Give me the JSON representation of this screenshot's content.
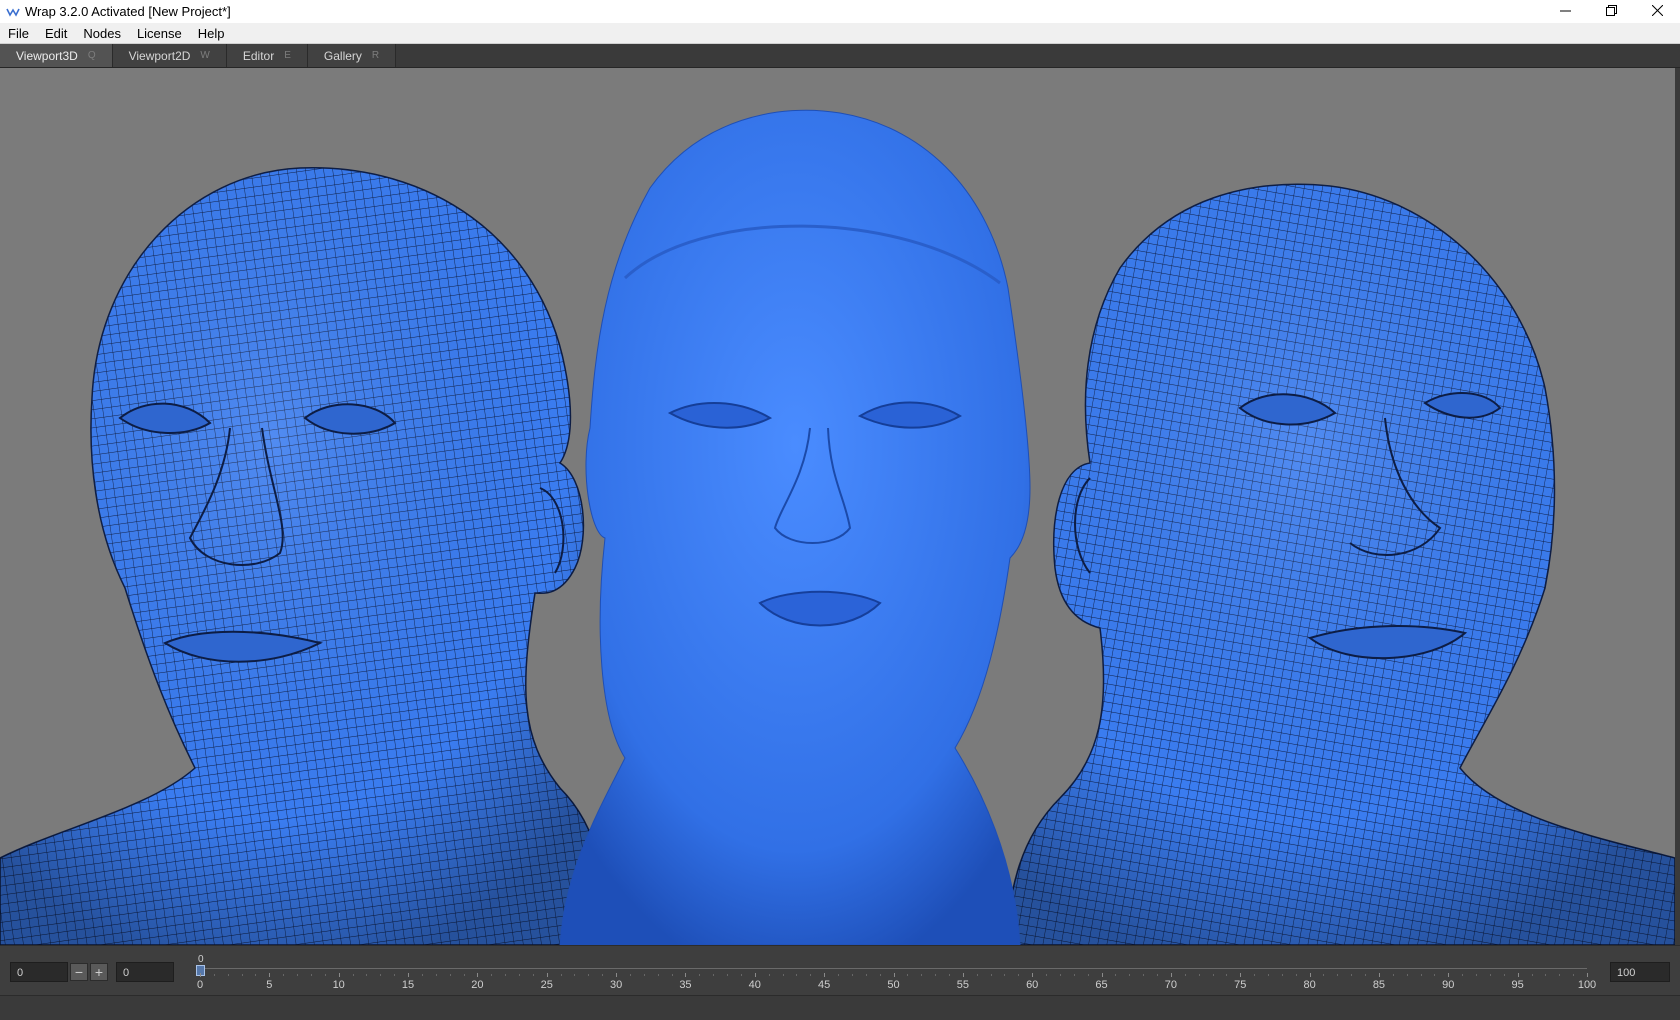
{
  "window": {
    "title": "Wrap 3.2.0 Activated [New Project*]",
    "controls": [
      "minimize-icon",
      "restore-icon",
      "close-icon"
    ]
  },
  "menu": {
    "items": [
      "File",
      "Edit",
      "Nodes",
      "License",
      "Help"
    ]
  },
  "tabs": [
    {
      "label": "Viewport3D",
      "shortcut": "Q",
      "active": true
    },
    {
      "label": "Viewport2D",
      "shortcut": "W",
      "active": false
    },
    {
      "label": "Editor",
      "shortcut": "E",
      "active": false
    },
    {
      "label": "Gallery",
      "shortcut": "R",
      "active": false
    }
  ],
  "viewport": {
    "background_color": "#7b7b7b",
    "mesh_color": "#3a7cf0",
    "wire_color": "#0d1d45"
  },
  "timeline": {
    "start_field": "0",
    "current_field": "0",
    "end_field": "100",
    "current_frame_label": "0",
    "minus_label": "−",
    "plus_label": "+",
    "ticks": [
      "0",
      "5",
      "10",
      "15",
      "20",
      "25",
      "30",
      "35",
      "40",
      "45",
      "50",
      "55",
      "60",
      "65",
      "70",
      "75",
      "80",
      "85",
      "90",
      "95",
      "100"
    ]
  }
}
